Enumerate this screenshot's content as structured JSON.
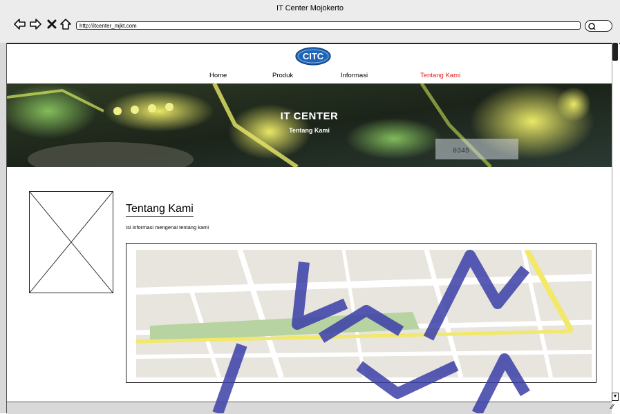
{
  "browser": {
    "window_title": "IT Center Mojokerto",
    "url": "http://itcenter_mjkt.com",
    "icons": [
      "back-arrow-icon",
      "forward-arrow-icon",
      "stop-icon",
      "home-icon",
      "search-icon"
    ]
  },
  "header": {
    "logo_text": "CITC",
    "nav": [
      {
        "label": "Home"
      },
      {
        "label": "Produk"
      },
      {
        "label": "Informasi"
      },
      {
        "label": "Tentang Kami",
        "active": true
      }
    ],
    "active_color": "#e0201c"
  },
  "hero": {
    "title": "IT CENTER",
    "subtitle": "Tentang Kami"
  },
  "content": {
    "heading": "Tentang Kami",
    "description": "Isi informasi mengenai tentang kami"
  },
  "watermark": {
    "lines": [
      "KTEK",
      "ATIKA",
      "YA"
    ],
    "color": "#3b3fa8"
  }
}
